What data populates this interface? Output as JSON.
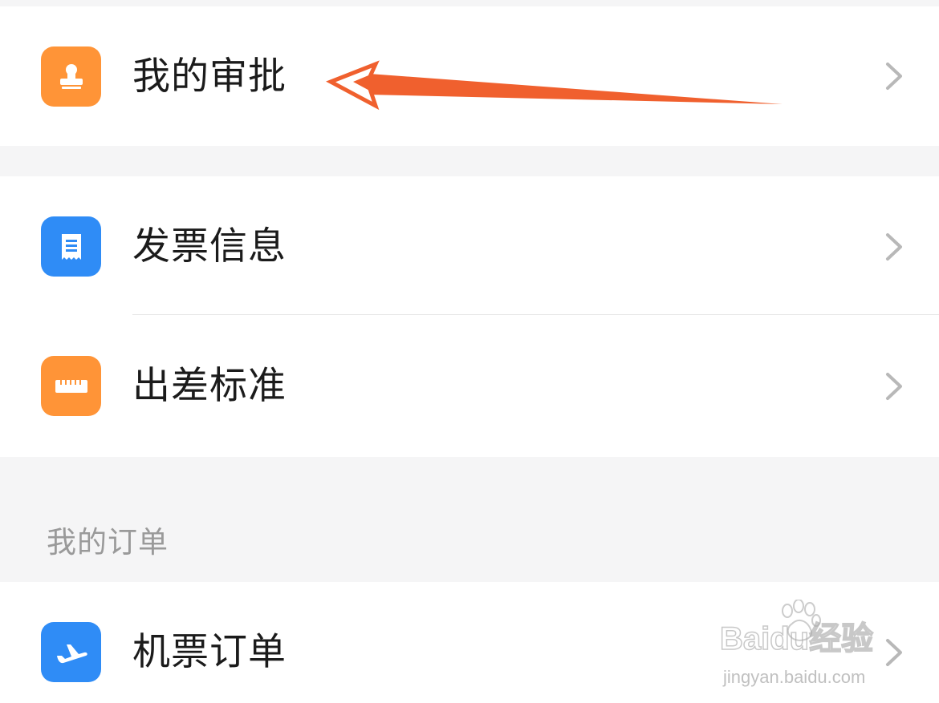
{
  "colors": {
    "approval_icon": "#ff9437",
    "invoice_icon": "#2f8cf6",
    "travel_icon": "#ff9437",
    "flight_icon": "#2f8cf6",
    "arrow": "#f0602e",
    "background": "#f5f5f6"
  },
  "menu_group_1": {
    "items": [
      {
        "label": "我的审批",
        "icon": "stamp-icon"
      }
    ]
  },
  "menu_group_2": {
    "items": [
      {
        "label": "发票信息",
        "icon": "receipt-icon"
      },
      {
        "label": "出差标准",
        "icon": "ruler-icon"
      }
    ]
  },
  "orders_section": {
    "title": "我的订单",
    "items": [
      {
        "label": "机票订单",
        "icon": "airplane-icon"
      }
    ]
  },
  "watermark": {
    "logo_text": "Baidu经验",
    "url_text": "jingyan.baidu.com"
  }
}
